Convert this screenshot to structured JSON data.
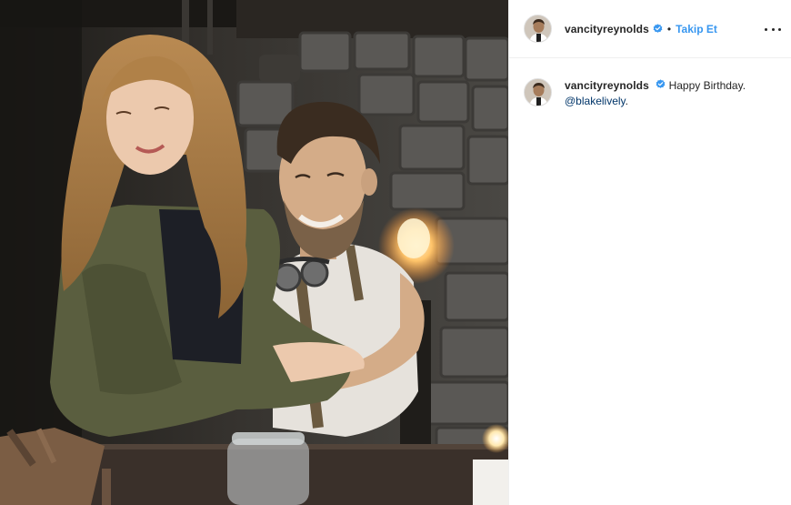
{
  "post": {
    "username": "vancityreynolds",
    "separator": "•",
    "follow_label": "Takip Et",
    "more_icon": "more-options-icon",
    "verified_icon": "verified-badge-icon",
    "verified_color": "#3897f0"
  },
  "caption": {
    "username": "vancityreynolds",
    "text": "Happy Birthday.",
    "mention": "@blakelively",
    "trailing": "."
  },
  "photo": {
    "description_icon": "post-photo"
  }
}
